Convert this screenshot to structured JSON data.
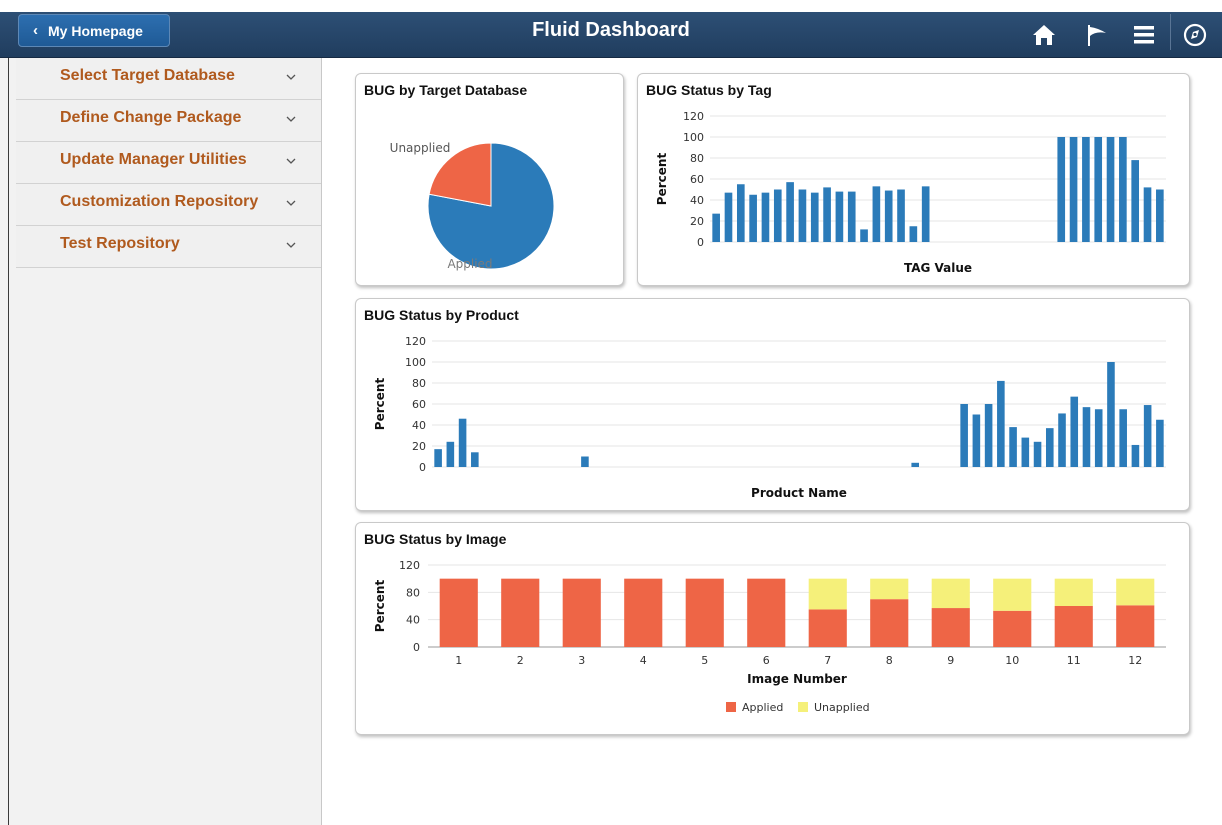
{
  "header": {
    "home_button_label": "My Homepage",
    "title": "Fluid Dashboard",
    "icons": [
      "home-icon",
      "flag-icon",
      "menu-icon",
      "navbar-compass-icon"
    ]
  },
  "sidebar": {
    "items": [
      {
        "label": "Select Target Database"
      },
      {
        "label": "Define Change Package"
      },
      {
        "label": "Update Manager Utilities"
      },
      {
        "label": "Customization Repository"
      },
      {
        "label": "Test Repository"
      }
    ]
  },
  "colors": {
    "header": "#203d5e",
    "sidebar_label": "#b05a1e",
    "bar_blue": "#2b7bb9",
    "applied": "#ee6546",
    "unapplied": "#f5f07a"
  },
  "chart_data": [
    {
      "type": "pie",
      "title": "BUG by Target Database",
      "labels": [
        "Applied",
        "Unapplied"
      ],
      "values": [
        78,
        22
      ]
    },
    {
      "type": "bar",
      "title": "BUG Status by Tag",
      "xlabel": "TAG Value",
      "ylabel": "Percent",
      "ylim": [
        0,
        120
      ],
      "yticks": [
        0,
        20,
        40,
        60,
        80,
        100,
        120
      ],
      "grid": true,
      "values": [
        27,
        47,
        55,
        45,
        47,
        50,
        57,
        50,
        47,
        52,
        48,
        48,
        12,
        53,
        49,
        50,
        15,
        53,
        0,
        0,
        0,
        0,
        0,
        0,
        0,
        0,
        0,
        0,
        100,
        100,
        100,
        100,
        100,
        100,
        78,
        52,
        50
      ]
    },
    {
      "type": "bar",
      "title": "BUG Status by Product",
      "xlabel": "Product Name",
      "ylabel": "Percent",
      "ylim": [
        0,
        120
      ],
      "yticks": [
        0,
        20,
        40,
        60,
        80,
        100,
        120
      ],
      "grid": true,
      "values": [
        17,
        24,
        46,
        14,
        0,
        0,
        0,
        0,
        0,
        0,
        0,
        0,
        10,
        0,
        0,
        0,
        0,
        0,
        0,
        0,
        0,
        0,
        0,
        0,
        0,
        0,
        0,
        0,
        0,
        0,
        0,
        0,
        0,
        0,
        0,
        0,
        0,
        0,
        0,
        4,
        0,
        0,
        0,
        60,
        50,
        60,
        82,
        38,
        28,
        24,
        37,
        51,
        67,
        57,
        55,
        100,
        55,
        21,
        59,
        45
      ]
    },
    {
      "type": "bar",
      "stacked": true,
      "title": "BUG Status by Image",
      "xlabel": "Image Number",
      "ylabel": "Percent",
      "ylim": [
        0,
        120
      ],
      "yticks": [
        0,
        40,
        80,
        120
      ],
      "grid": true,
      "legend": "bottom",
      "categories": [
        "1",
        "2",
        "3",
        "4",
        "5",
        "6",
        "7",
        "8",
        "9",
        "10",
        "11",
        "12"
      ],
      "series": [
        {
          "name": "Applied",
          "values": [
            100,
            100,
            100,
            100,
            100,
            100,
            55,
            70,
            57,
            53,
            60,
            61
          ]
        },
        {
          "name": "Unapplied",
          "values": [
            0,
            0,
            0,
            0,
            0,
            0,
            45,
            30,
            43,
            47,
            40,
            39
          ]
        }
      ]
    }
  ]
}
